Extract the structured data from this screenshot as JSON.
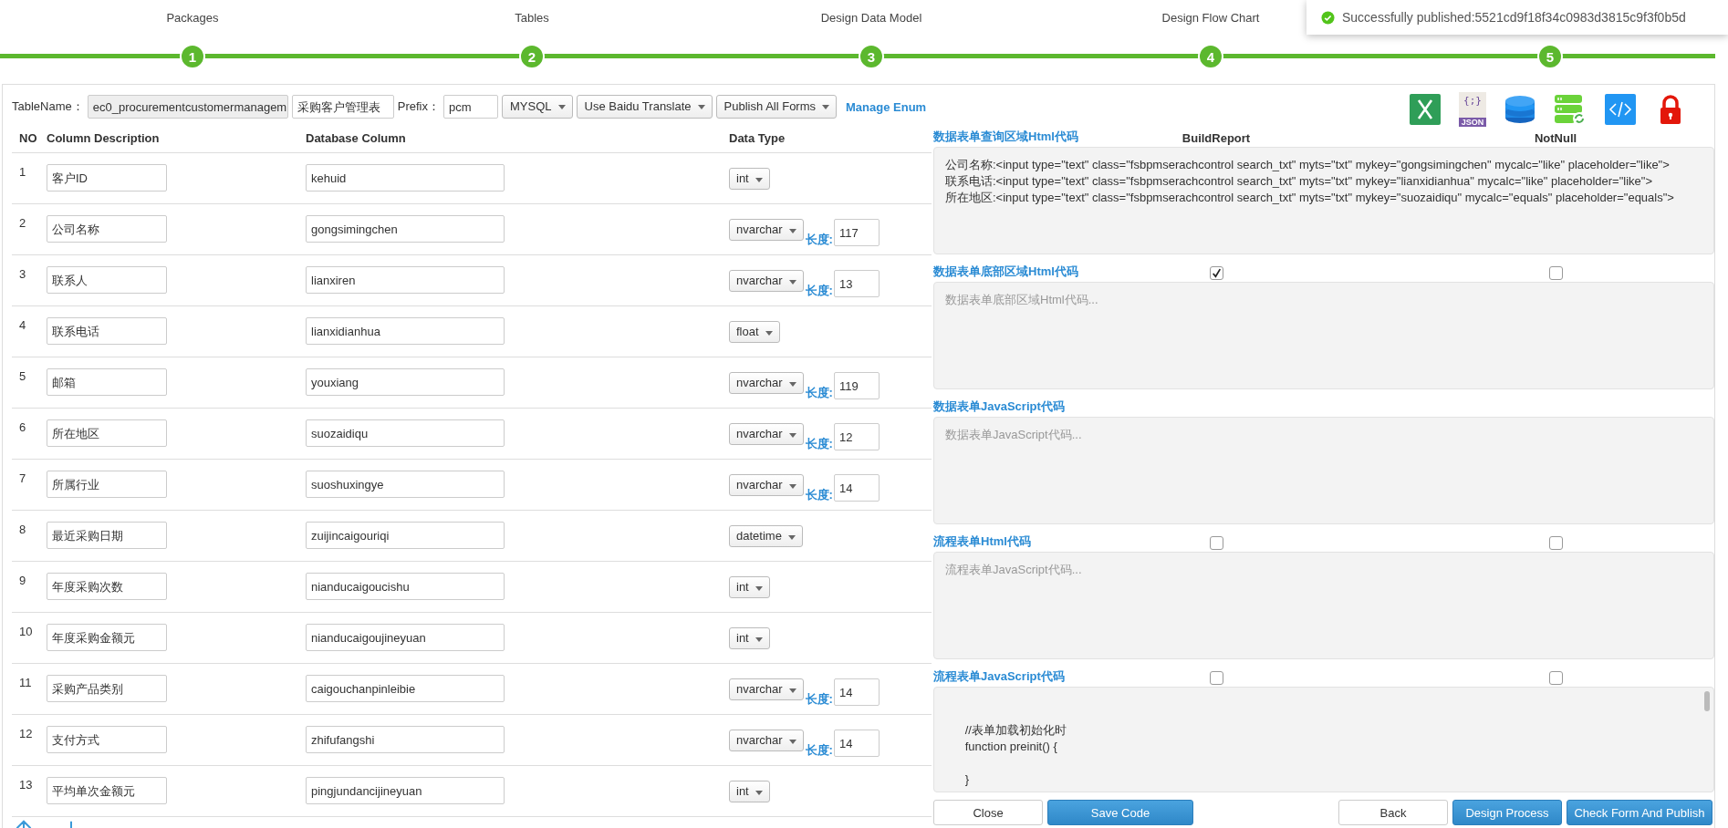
{
  "steps": [
    {
      "label": "Packages",
      "number": "1"
    },
    {
      "label": "Tables",
      "number": "2"
    },
    {
      "label": "Design Data Model",
      "number": "3"
    },
    {
      "label": "Design Flow Chart",
      "number": "4"
    },
    {
      "number": "5"
    }
  ],
  "toast": {
    "message": "Successfully published:5521cd9f18f34c0983d3815c9f3f0b5d"
  },
  "toolbar": {
    "table_name_label": "TableName：",
    "table_name": "ec0_procurementcustomermanagem",
    "table_title": "采购客户管理表",
    "prefix_label": "Prefix：",
    "prefix": "pcm",
    "selects": [
      "MYSQL",
      "Use Baidu Translate",
      "Publish All Forms"
    ],
    "manage_link": "Manage Enum"
  },
  "table": {
    "columns": [
      "NO",
      "Column Description",
      "Database Column",
      "Data Type"
    ],
    "rows": [
      {
        "no": "1",
        "description": "客户ID",
        "column": "kehuid",
        "type": "int"
      },
      {
        "no": "2",
        "description": "公司名称",
        "column": "gongsimingchen",
        "type": "nvarchar",
        "length_label": "长度:",
        "length": "117"
      },
      {
        "no": "3",
        "description": "联系人",
        "column": "lianxiren",
        "type": "nvarchar",
        "length_label": "长度:",
        "length": "13"
      },
      {
        "no": "4",
        "description": "联系电话",
        "column": "lianxidianhua",
        "type": "float"
      },
      {
        "no": "5",
        "description": "邮箱",
        "column": "youxiang",
        "type": "nvarchar",
        "length_label": "长度:",
        "length": "119"
      },
      {
        "no": "6",
        "description": "所在地区",
        "column": "suozaidiqu",
        "type": "nvarchar",
        "length_label": "长度:",
        "length": "12"
      },
      {
        "no": "7",
        "description": "所属行业",
        "column": "suoshuxingye",
        "type": "nvarchar",
        "length_label": "长度:",
        "length": "14"
      },
      {
        "no": "8",
        "description": "最近采购日期",
        "column": "zuijincaigouriqi",
        "type": "datetime"
      },
      {
        "no": "9",
        "description": "年度采购次数",
        "column": "nianducaigoucishu",
        "type": "int"
      },
      {
        "no": "10",
        "description": "年度采购金额元",
        "column": "nianducaigoujineyuan",
        "type": "int"
      },
      {
        "no": "11",
        "description": "采购产品类别",
        "column": "caigouchanpinleibie",
        "type": "nvarchar",
        "length_label": "长度:",
        "length": "14"
      },
      {
        "no": "12",
        "description": "支付方式",
        "column": "zhifufangshi",
        "type": "nvarchar",
        "length_label": "长度:",
        "length": "14"
      },
      {
        "no": "13",
        "description": "平均单次金额元",
        "column": "pingjundancijineyuan",
        "type": "int"
      }
    ]
  },
  "panel": {
    "icons": [
      {
        "kind": "excel"
      },
      {
        "kind": "json",
        "glyph": "{;}",
        "text": "JSON"
      },
      {
        "kind": "database"
      },
      {
        "kind": "server"
      },
      {
        "kind": "code"
      },
      {
        "kind": "lock"
      }
    ],
    "columns": [
      "BuildReport",
      "NotNull"
    ],
    "sections": [
      {
        "title": "数据表单查询区域Html代码",
        "value": "公司名称:<input type=\"text\" class=\"fsbpmserachcontrol search_txt\" myts=\"txt\" mykey=\"gongsimingchen\" mycalc=\"like\" placeholder=\"like\">\n联系电话:<input type=\"text\" class=\"fsbpmserachcontrol search_txt\" myts=\"txt\" mykey=\"lianxidianhua\" mycalc=\"like\" placeholder=\"like\">\n所在地区:<input type=\"text\" class=\"fsbpmserachcontrol search_txt\" myts=\"txt\" mykey=\"suozaidiqu\" mycalc=\"equals\" placeholder=\"equals\">"
      },
      {
        "title": "数据表单底部区域Html代码",
        "placeholder": "数据表单底部区域Html代码...",
        "build_report": true,
        "not_null": false
      },
      {
        "title": "数据表单JavaScript代码",
        "placeholder": "数据表单JavaScript代码..."
      },
      {
        "title": "流程表单Html代码",
        "placeholder": "流程表单JavaScript代码...",
        "build_report": false,
        "not_null": false
      },
      {
        "title": "流程表单JavaScript代码",
        "value": "\n\n      //表单加载初始化时\n      function preinit() {\n\n      }",
        "build_report": false,
        "not_null": false
      }
    ]
  },
  "footer": {
    "left": [
      {
        "label": "Close",
        "kind": "default"
      },
      {
        "label": "Save Code",
        "kind": "primary"
      }
    ],
    "right": [
      {
        "label": "Back",
        "kind": "default"
      },
      {
        "label": "Design Process",
        "kind": "primary"
      },
      {
        "label": "Check Form And Publish",
        "kind": "primary"
      }
    ]
  }
}
